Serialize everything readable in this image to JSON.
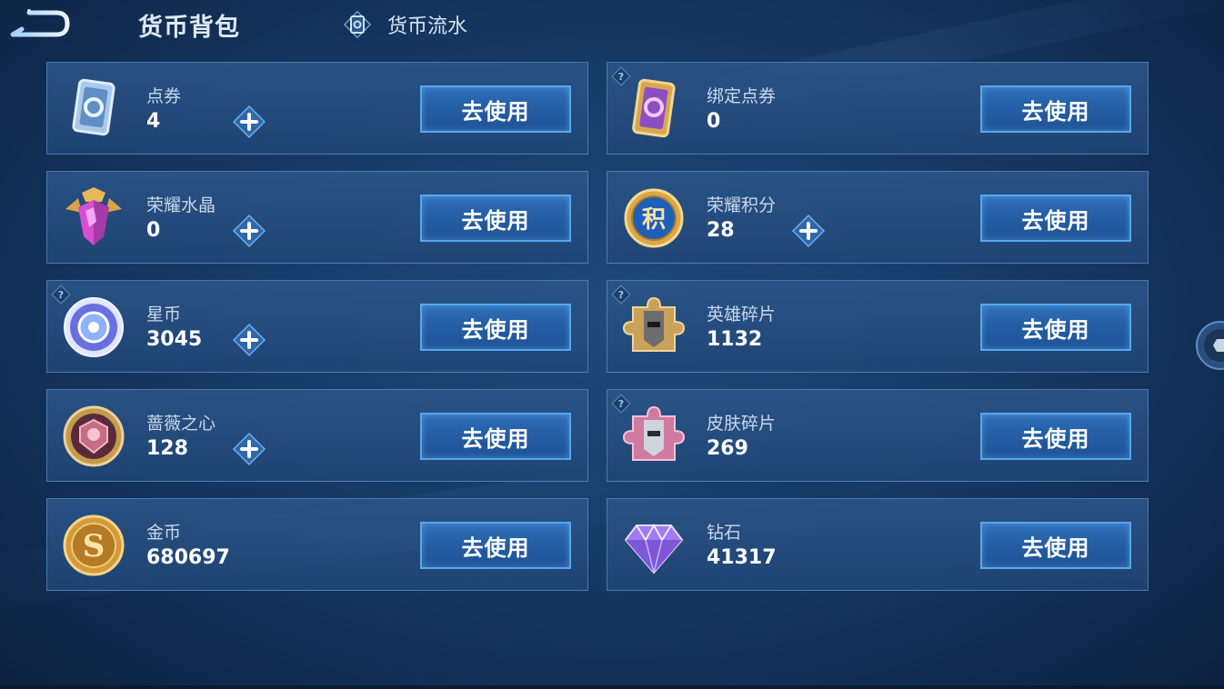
{
  "header": {
    "title": "货币背包",
    "flow_tab_label": "货币流水"
  },
  "colors": {
    "background": "#173a66",
    "card": "#2a5589",
    "button": "#2a65ad",
    "button_border": "#55a7ee"
  },
  "cards": [
    {
      "name": "点券",
      "value": "4",
      "icon": "voucher-card-icon",
      "has_plus": true,
      "has_help": false,
      "button": "去使用"
    },
    {
      "name": "绑定点券",
      "value": "0",
      "icon": "bound-voucher-card-icon",
      "has_plus": false,
      "has_help": true,
      "button": "去使用"
    },
    {
      "name": "荣耀水晶",
      "value": "0",
      "icon": "glory-crystal-icon",
      "has_plus": true,
      "has_help": false,
      "button": "去使用"
    },
    {
      "name": "荣耀积分",
      "value": "28",
      "icon": "glory-points-icon",
      "has_plus": true,
      "has_help": false,
      "button": "去使用"
    },
    {
      "name": "星币",
      "value": "3045",
      "icon": "star-coin-icon",
      "has_plus": true,
      "has_help": true,
      "button": "去使用"
    },
    {
      "name": "英雄碎片",
      "value": "1132",
      "icon": "hero-fragment-icon",
      "has_plus": false,
      "has_help": true,
      "button": "去使用"
    },
    {
      "name": "蔷薇之心",
      "value": "128",
      "icon": "rose-heart-icon",
      "has_plus": true,
      "has_help": false,
      "button": "去使用"
    },
    {
      "name": "皮肤碎片",
      "value": "269",
      "icon": "skin-fragment-icon",
      "has_plus": false,
      "has_help": true,
      "button": "去使用"
    },
    {
      "name": "金币",
      "value": "680697",
      "icon": "gold-coin-icon",
      "has_plus": false,
      "has_help": false,
      "button": "去使用"
    },
    {
      "name": "钻石",
      "value": "41317",
      "icon": "diamond-icon",
      "has_plus": false,
      "has_help": false,
      "button": "去使用"
    }
  ]
}
